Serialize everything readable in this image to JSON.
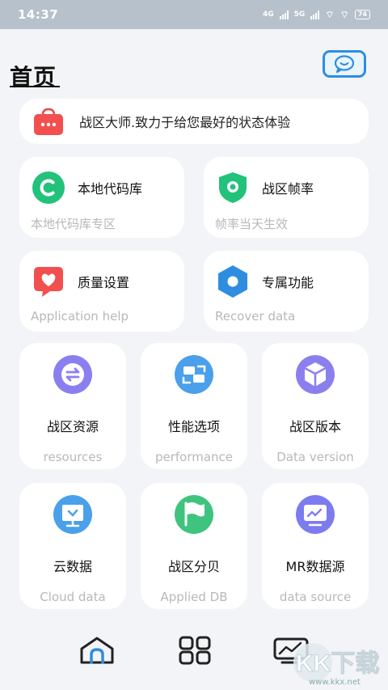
{
  "status": {
    "time": "14:37",
    "net1": "4G",
    "net2": "5G",
    "battery": "74"
  },
  "header": {
    "title": "首页"
  },
  "banner": {
    "text": "战区大师.致力于给您最好的状态体验"
  },
  "mid_cards": [
    {
      "title": "本地代码库",
      "subtitle": "本地代码库专区",
      "icon": "c-letter-icon",
      "color": "#22c27a"
    },
    {
      "title": "战区帧率",
      "subtitle": "帧率当天生效",
      "icon": "shield-eye-icon",
      "color": "#22c27a"
    },
    {
      "title": "质量设置",
      "subtitle": "Application help",
      "icon": "heart-chat-icon",
      "color": "#f2504f"
    },
    {
      "title": "专属功能",
      "subtitle": "Recover data",
      "icon": "hexagon-icon",
      "color": "#2f8de0"
    }
  ],
  "grid_cards": [
    {
      "title": "战区资源",
      "subtitle": "resources",
      "icon": "sync-icon",
      "color": "#8b7ff0"
    },
    {
      "title": "性能选项",
      "subtitle": "performance",
      "icon": "swap-icon",
      "color": "#4aa0ea"
    },
    {
      "title": "战区版本",
      "subtitle": "Data version",
      "icon": "cube-icon",
      "color": "#8b7ff0"
    },
    {
      "title": "云数据",
      "subtitle": "Cloud data",
      "icon": "board-icon",
      "color": "#4aa0ea"
    },
    {
      "title": "战区分贝",
      "subtitle": "Applied DB",
      "icon": "flag-icon",
      "color": "#3ec47e"
    },
    {
      "title": "MR数据源",
      "subtitle": "data source",
      "icon": "monitor-icon",
      "color": "#7c7cf0"
    }
  ],
  "nav": [
    {
      "icon": "home-icon"
    },
    {
      "icon": "grid-icon"
    },
    {
      "icon": "chart-screen-icon"
    }
  ],
  "watermark": {
    "text": "KK下载",
    "site": "www.kkx.net"
  }
}
